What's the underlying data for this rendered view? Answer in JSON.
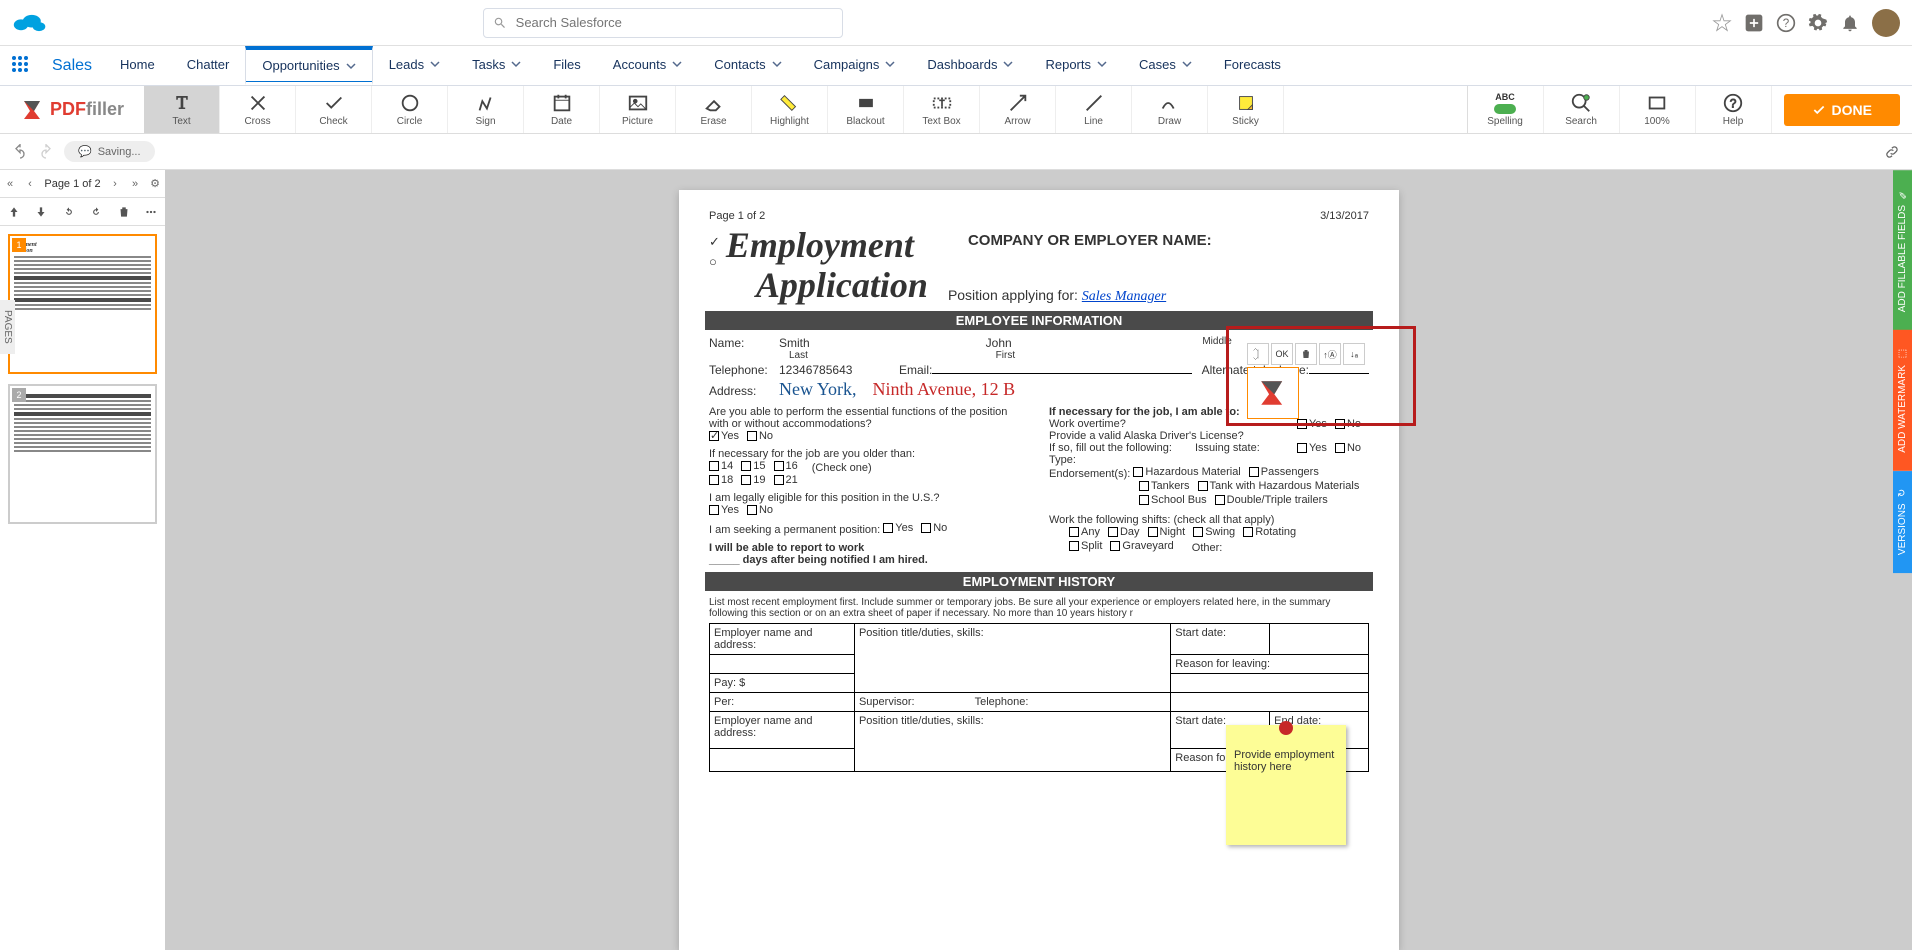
{
  "sf": {
    "search_placeholder": "Search Salesforce",
    "app_name": "Sales",
    "nav_items": [
      {
        "label": "Home",
        "active": false,
        "dd": false
      },
      {
        "label": "Chatter",
        "active": false,
        "dd": false
      },
      {
        "label": "Opportunities",
        "active": true,
        "dd": true
      },
      {
        "label": "Leads",
        "active": false,
        "dd": true
      },
      {
        "label": "Tasks",
        "active": false,
        "dd": true
      },
      {
        "label": "Files",
        "active": false,
        "dd": false
      },
      {
        "label": "Accounts",
        "active": false,
        "dd": true
      },
      {
        "label": "Contacts",
        "active": false,
        "dd": true
      },
      {
        "label": "Campaigns",
        "active": false,
        "dd": true
      },
      {
        "label": "Dashboards",
        "active": false,
        "dd": true
      },
      {
        "label": "Reports",
        "active": false,
        "dd": true
      },
      {
        "label": "Cases",
        "active": false,
        "dd": true
      },
      {
        "label": "Forecasts",
        "active": false,
        "dd": false
      }
    ]
  },
  "pf": {
    "logo_text": "PDFfiller",
    "tools": [
      "Text",
      "Cross",
      "Check",
      "Circle",
      "Sign",
      "Date",
      "Picture",
      "Erase",
      "Highlight",
      "Blackout",
      "Text Box",
      "Arrow",
      "Line",
      "Draw",
      "Sticky"
    ],
    "right_tools": [
      "Spelling",
      "Search",
      "100%",
      "Help"
    ],
    "done": "DONE",
    "status": "Saving...",
    "pager": "Page 1 of 2"
  },
  "doc": {
    "page_info": "Page 1 of 2",
    "date": "3/13/2017",
    "title1": "Employment",
    "title2": "Application",
    "company_label": "COMPANY OR EMPLOYER NAME:",
    "position_label": "Position applying for:",
    "position_val": "Sales Manager",
    "sec_emp_info": "EMPLOYEE INFORMATION",
    "name_label": "Name:",
    "last_name": "Smith",
    "first_name": "John",
    "last_l": "Last",
    "first_l": "First",
    "middle_l": "Middle",
    "tel_label": "Telephone:",
    "tel_val": "12346785643",
    "email_label": "Email:",
    "alt_tel_label": "Alternate telephone:",
    "addr_label": "Address:",
    "addr_city": "New York,",
    "addr_street": "Ninth Avenue, 12 B",
    "q_essential": "Are you able to perform the essential functions of the position with or without accommodations?",
    "yes": "Yes",
    "no": "No",
    "q_older": "If necessary for the job are you older than:",
    "ages": [
      "14",
      "15",
      "16",
      "18",
      "19",
      "21"
    ],
    "check_one": "(Check one)",
    "q_eligible": "I am legally eligible for this position in the U.S.?",
    "q_perm": "I am seeking a permanent position:",
    "report_line1": "I will be able to report to work",
    "report_line2": "_____ days after being notified I am hired.",
    "q_necessary": "If necessary for the job, I am able to:",
    "work_ot": "Work overtime?",
    "alaska": "Provide a valid Alaska Driver's License?",
    "fill_out": "If so, fill out the following:",
    "issuing": "Issuing state:",
    "type": "Type:",
    "endorsements": "Endorsement(s):",
    "end_opts": [
      "Hazardous Material",
      "Passengers",
      "Tankers",
      "Tank with Hazardous Materials",
      "School Bus",
      "Double/Triple trailers"
    ],
    "shifts_q": "Work the following shifts: (check all that apply)",
    "shift_opts": [
      "Any",
      "Day",
      "Night",
      "Swing",
      "Rotating",
      "Split",
      "Graveyard"
    ],
    "other": "Other:",
    "sec_history": "EMPLOYMENT HISTORY",
    "history_intro": "List most recent employment first. Include summer or temporary jobs. Be sure all your experience or employers related here, in the summary following this section or on an extra sheet of paper if necessary. No more than 10 years history r",
    "col_employer": "Employer name and address:",
    "col_position": "Position title/duties, skills:",
    "col_start": "Start date:",
    "col_end": "End date:",
    "col_reason": "Reason for leaving:",
    "col_pay": "Pay:    $",
    "col_per": "Per:",
    "col_supervisor": "Supervisor:",
    "col_telephone": "Telephone:"
  },
  "sticky": {
    "text": "Provide employment history here"
  },
  "callout": {
    "ok": "OK"
  },
  "side_tabs": {
    "fillable": "ADD FILLABLE FIELDS",
    "watermark": "ADD WATERMARK",
    "versions": "VERSIONS"
  }
}
